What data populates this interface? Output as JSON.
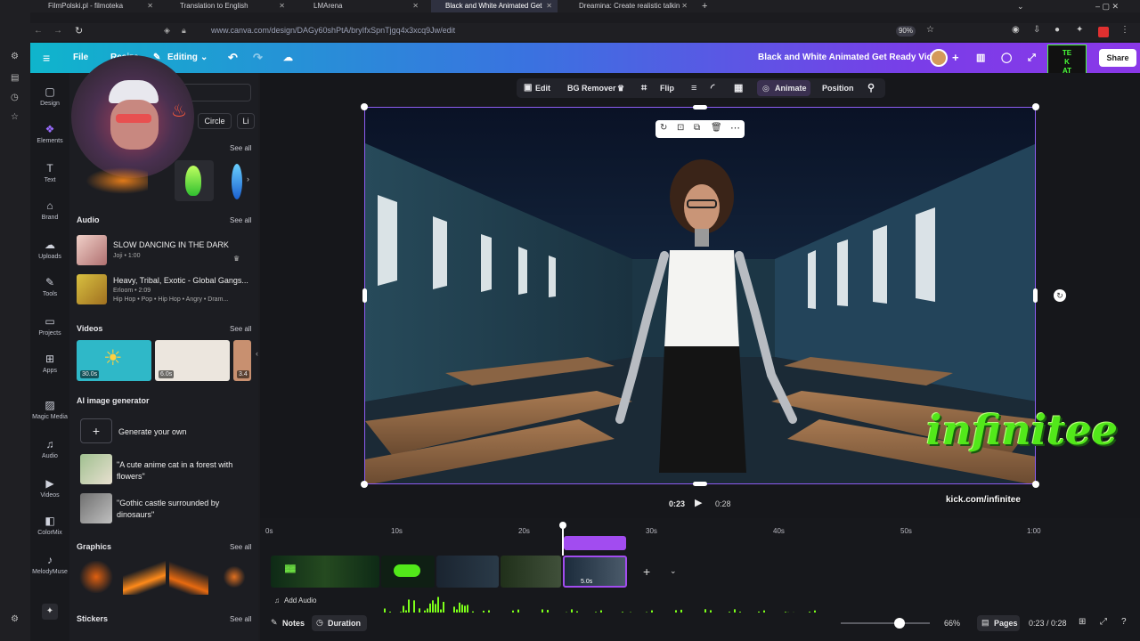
{
  "browser": {
    "tabs": [
      {
        "label": "FilmPolski.pl - filmoteka"
      },
      {
        "label": "Translation to English"
      },
      {
        "label": "LMArena"
      },
      {
        "label": "Black and White Animated Get"
      },
      {
        "label": "Dreamina: Create realistic talkin"
      }
    ],
    "url": "www.canva.com/design/DAGy60shPtA/bryIfxSpnTjgq4x3xcq9Jw/edit",
    "zoom": "90%"
  },
  "header": {
    "file": "File",
    "resize": "Resize",
    "editing": "Editing",
    "design_title": "Black and White Animated Get Ready Video",
    "share": "Share"
  },
  "rail": [
    {
      "label": "Design",
      "icon": "layout-icon"
    },
    {
      "label": "Elements",
      "icon": "shapes-icon"
    },
    {
      "label": "Text",
      "icon": "text-icon"
    },
    {
      "label": "Brand",
      "icon": "briefcase-icon"
    },
    {
      "label": "Uploads",
      "icon": "cloud-upload-icon"
    },
    {
      "label": "Tools",
      "icon": "pen-icon"
    },
    {
      "label": "Projects",
      "icon": "folder-icon"
    },
    {
      "label": "Apps",
      "icon": "apps-icon"
    },
    {
      "label": "Magic Media",
      "icon": "magic-media-icon"
    },
    {
      "label": "Audio",
      "icon": "music-icon"
    },
    {
      "label": "Videos",
      "icon": "video-icon"
    },
    {
      "label": "ColorMix",
      "icon": "colormix-icon"
    },
    {
      "label": "MelodyMuse",
      "icon": "melodymuse-icon"
    }
  ],
  "panel": {
    "chips": [
      "Circle",
      "Li"
    ],
    "see_all": "See all",
    "audio_title": "Audio",
    "audio": [
      {
        "title": "SLOW DANCING IN THE DARK",
        "meta": "Joji • 1:00"
      },
      {
        "title": "Heavy, Tribal, Exotic - Global Gangs...",
        "meta": "Erloom • 2:09",
        "tags": "Hip Hop • Pop • Hip Hop • Angry • Dram..."
      }
    ],
    "videos_title": "Videos",
    "videos": [
      {
        "duration": "30.0s"
      },
      {
        "duration": "6.0s"
      },
      {
        "duration": "3.4"
      }
    ],
    "ai_title": "AI image generator",
    "generate_label": "Generate your own",
    "prompts": [
      {
        "text": "\"A cute anime cat in a forest with flowers\""
      },
      {
        "text": "\"Gothic castle surrounded by dinosaurs\""
      }
    ],
    "graphics_title": "Graphics",
    "stickers_title": "Stickers"
  },
  "toolbar": {
    "edit": "Edit",
    "bg_remover": "BG Remover",
    "flip": "Flip",
    "animate": "Animate",
    "position": "Position"
  },
  "playback": {
    "current": "0:23",
    "total": "0:28"
  },
  "timeline": {
    "ticks": [
      "0s",
      "10s",
      "20s",
      "30s",
      "40s",
      "50s",
      "1:00"
    ],
    "clip_duration": "5.0s",
    "add_audio": "Add Audio"
  },
  "bottom": {
    "notes": "Notes",
    "duration": "Duration",
    "zoom_percent": "66%",
    "zoom_level": 0.66,
    "pages": "Pages",
    "time": "0:23 / 0:28"
  },
  "watermark": {
    "brand": "infinitee",
    "url": "kick.com/infinitee"
  },
  "colors": {
    "accent": "#8b3dff",
    "header_start": "#0fb5cc",
    "header_end": "#8a38e8",
    "audio_wave": "#7dff1a"
  }
}
